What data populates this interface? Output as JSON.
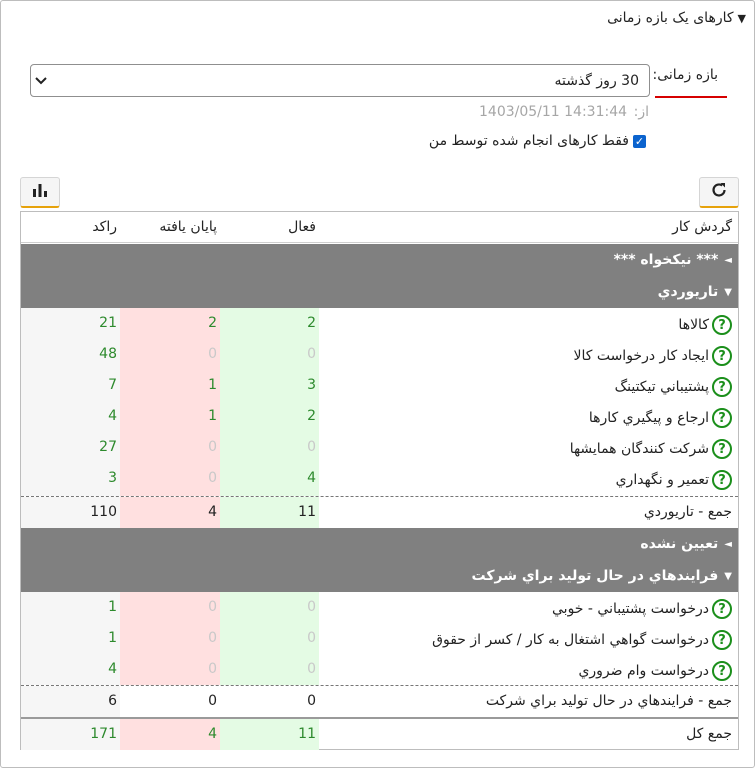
{
  "widget": {
    "title": "کارهای یک بازه زمانی"
  },
  "filter": {
    "period_label": "بازه زمانی:",
    "period_value": "30 روز گذشته",
    "from_label": "از:",
    "from_value": "1403/05/11 14:31:44",
    "only_mine_label": "فقط کارهای انجام شده توسط من",
    "only_mine_checked": true
  },
  "toolbar": {
    "chart_icon": "bar-chart-icon",
    "refresh_icon": "refresh-icon"
  },
  "colors": {
    "accent": "#e6a20b",
    "group_bg": "#808080",
    "active_bg": "#e4fbe4",
    "ended_bg": "#ffe0e0",
    "green_text": "#2d8a2d",
    "underline": "#d60000"
  },
  "table": {
    "headers": {
      "workflow": "گردش کار",
      "active": "فعال",
      "ended": "پایان یافته",
      "stagnant": "راکد"
    },
    "groups": [
      {
        "label": "*** نیکخواه ***",
        "tri": "◄"
      },
      {
        "label": "تاریوردي",
        "tri": "▼",
        "rows": [
          {
            "name": "کالاها",
            "active": "2",
            "ended": "2",
            "stagnant": "21"
          },
          {
            "name": "ایجاد کار درخواست کالا",
            "active": "0",
            "ended": "0",
            "stagnant": "48"
          },
          {
            "name": "پشتیباني تیکتینگ",
            "active": "3",
            "ended": "1",
            "stagnant": "7"
          },
          {
            "name": "ارجاع و پیگیري کارها",
            "active": "2",
            "ended": "1",
            "stagnant": "4"
          },
          {
            "name": "شرکت کنندگان همایشها",
            "active": "0",
            "ended": "0",
            "stagnant": "27"
          },
          {
            "name": "تعمیر و نگهداري",
            "active": "4",
            "ended": "0",
            "stagnant": "3"
          }
        ],
        "total": {
          "label": "جمع - تاریوردي",
          "active": "11",
          "ended": "4",
          "stagnant": "110"
        }
      },
      {
        "label": "تعیین نشده",
        "tri": "◄"
      },
      {
        "label": "فرایندهاي در حال تولید براي شرکت",
        "tri": "▼",
        "rows": [
          {
            "name": "درخواست پشتیباني - خوبي",
            "active": "0",
            "ended": "0",
            "stagnant": "1"
          },
          {
            "name": "درخواست گواهي اشتغال به کار / کسر از حقوق",
            "active": "0",
            "ended": "0",
            "stagnant": "1"
          },
          {
            "name": "درخواست وام ضروري",
            "active": "0",
            "ended": "0",
            "stagnant": "4"
          }
        ],
        "total": {
          "label": "جمع - فرایندهاي در حال تولید براي شرکت",
          "active": "0",
          "ended": "0",
          "stagnant": "6"
        }
      }
    ],
    "grand_total": {
      "label": "جمع کل",
      "active": "11",
      "ended": "4",
      "stagnant": "171"
    }
  }
}
